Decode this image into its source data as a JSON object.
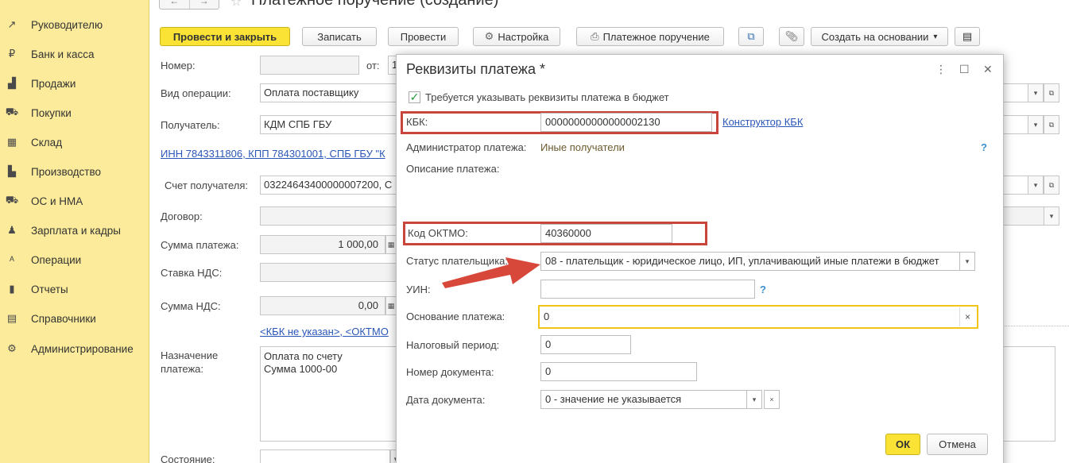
{
  "window": {
    "title": "Платежное поручение (создание)",
    "nav_back": "←",
    "nav_forward": "→"
  },
  "sidebar": {
    "items": [
      {
        "label": "Руководителю",
        "icon": "trend-icon",
        "glyph": "↗"
      },
      {
        "label": "Банк и касса",
        "icon": "ruble-coin-icon",
        "glyph": "₽"
      },
      {
        "label": "Продажи",
        "icon": "bag-icon",
        "glyph": "▟"
      },
      {
        "label": "Покупки",
        "icon": "cart-icon",
        "glyph": "⛟"
      },
      {
        "label": "Склад",
        "icon": "warehouse-icon",
        "glyph": "▦"
      },
      {
        "label": "Производство",
        "icon": "factory-icon",
        "glyph": "▙"
      },
      {
        "label": "ОС и НМА",
        "icon": "truck-icon",
        "glyph": "⛟"
      },
      {
        "label": "Зарплата и кадры",
        "icon": "person-icon",
        "glyph": "♟"
      },
      {
        "label": "Операции",
        "icon": "operations-icon",
        "glyph": "ᴬ"
      },
      {
        "label": "Отчеты",
        "icon": "bar-chart-icon",
        "glyph": "▮"
      },
      {
        "label": "Справочники",
        "icon": "books-icon",
        "glyph": "▤"
      },
      {
        "label": "Администрирование",
        "icon": "gear-icon",
        "glyph": "⚙"
      }
    ]
  },
  "toolbar": {
    "post_close": "Провести и закрыть",
    "save": "Записать",
    "post": "Провести",
    "settings": "Настройка",
    "print_order": "Платежное поручение",
    "create_based": "Создать на основании",
    "dropdown_glyph": "▾"
  },
  "form": {
    "number_label": "Номер:",
    "number_value": "",
    "date_label": "от:",
    "date_value": "1",
    "op_type_label": "Вид операции:",
    "op_type_value": "Оплата поставщику",
    "recipient_label": "Получатель:",
    "recipient_value": "КДМ СПБ ГБУ",
    "inn_link": "ИНН 7843311806, КПП 784301001, СПБ ГБУ \"К",
    "account_label": "Счет получателя:",
    "account_value": "03224643400000007200, С",
    "contract_label": "Договор:",
    "contract_value": "",
    "sum_label": "Сумма платежа:",
    "sum_value": "1 000,00",
    "vat_rate_label": "Ставка НДС:",
    "vat_rate_value": "",
    "vat_sum_label": "Сумма НДС:",
    "vat_sum_value": "0,00",
    "kbk_link": "<КБК не указан>, <ОКТМО",
    "purpose_label": "Назначение\nплатежа:",
    "purpose_value": "Оплата по счету\nСумма 1000-00",
    "state_label": "Состояние:"
  },
  "dialog": {
    "title": "Реквизиты платежа *",
    "budget_checkbox_label": "Требуется указывать реквизиты платежа в бюджет",
    "budget_checked": true,
    "kbk_label": "КБК:",
    "kbk_value": "00000000000000002130",
    "kbk_constructor": "Конструктор КБК",
    "admin_label": "Администратор платежа:",
    "admin_value": "Иные получатели",
    "desc_label": "Описание платежа:",
    "oktmo_label": "Код ОКТМО:",
    "oktmo_value": "40360000",
    "payer_status_label": "Статус плательщика:",
    "payer_status_value": "08 - плательщик - юридическое лицо, ИП, уплачивающий иные платежи в бюджет",
    "uin_label": "УИН:",
    "uin_value": "",
    "basis_label": "Основание платежа:",
    "basis_value": "0",
    "tax_period_label": "Налоговый период:",
    "tax_period_value": "0",
    "doc_number_label": "Номер документа:",
    "doc_number_value": "0",
    "doc_date_label": "Дата документа:",
    "doc_date_value": "0 - значение не указывается",
    "ok": "ОК",
    "cancel": "Отмена",
    "help_glyph": "?",
    "clear_glyph": "×",
    "more_glyph": "⋮",
    "maximize_glyph": "☐",
    "close_glyph": "✕"
  },
  "colors": {
    "sidebar_bg": "#fbeb9a",
    "primary_button": "#fbe335",
    "highlight_red": "#c9443a",
    "focus_yellow": "#f0c419",
    "link_blue": "#2a56b8"
  }
}
